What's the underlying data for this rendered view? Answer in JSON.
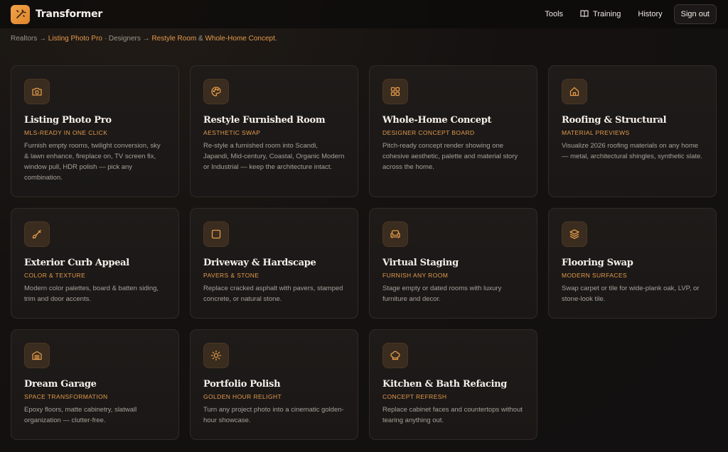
{
  "header": {
    "brand": "Transformer",
    "nav": [
      {
        "label": "Tools",
        "icon": ""
      },
      {
        "label": "Training",
        "icon": "book-icon"
      },
      {
        "label": "History",
        "icon": ""
      }
    ],
    "signout": "Sign out"
  },
  "intro": {
    "realtors": "Realtors →",
    "listing_photo_pro": "Listing Photo Pro",
    "designers": "· Designers →",
    "restyle_room": "Restyle Room",
    "amp": "&",
    "whole_home": "Whole-Home Concept",
    "period": "."
  },
  "colors": {
    "accent": "#e39a4b",
    "bg": "#141110",
    "card": "#1c1917"
  },
  "cards": [
    {
      "icon": "camera-icon",
      "title": "Listing Photo Pro",
      "subtitle": "MLS-READY IN ONE CLICK",
      "desc": "Furnish empty rooms, twilight conversion, sky & lawn enhance, fireplace on, TV screen fix, window pull, HDR polish — pick any combination."
    },
    {
      "icon": "palette-icon",
      "title": "Restyle Furnished Room",
      "subtitle": "AESTHETIC SWAP",
      "desc": "Re-style a furnished room into Scandi, Japandi, Mid-century, Coastal, Organic Modern or Industrial — keep the architecture intact."
    },
    {
      "icon": "grid-icon",
      "title": "Whole-Home Concept",
      "subtitle": "DESIGNER CONCEPT BOARD",
      "desc": "Pitch-ready concept render showing one cohesive aesthetic, palette and material story across the home."
    },
    {
      "icon": "home-icon",
      "title": "Roofing & Structural",
      "subtitle": "MATERIAL PREVIEWS",
      "desc": "Visualize 2026 roofing materials on any home — metal, architectural shingles, synthetic slate."
    },
    {
      "icon": "paintbrush-icon",
      "title": "Exterior Curb Appeal",
      "subtitle": "COLOR & TEXTURE",
      "desc": "Modern color palettes, board & batten siding, trim and door accents."
    },
    {
      "icon": "square-icon",
      "title": "Driveway & Hardscape",
      "subtitle": "PAVERS & STONE",
      "desc": "Replace cracked asphalt with pavers, stamped concrete, or natural stone."
    },
    {
      "icon": "sofa-icon",
      "title": "Virtual Staging",
      "subtitle": "FURNISH ANY ROOM",
      "desc": "Stage empty or dated rooms with luxury furniture and decor."
    },
    {
      "icon": "layers-icon",
      "title": "Flooring Swap",
      "subtitle": "MODERN SURFACES",
      "desc": "Swap carpet or tile for wide-plank oak, LVP, or stone-look tile."
    },
    {
      "icon": "garage-icon",
      "title": "Dream Garage",
      "subtitle": "SPACE TRANSFORMATION",
      "desc": "Epoxy floors, matte cabinetry, slatwall organization — clutter-free."
    },
    {
      "icon": "sun-icon",
      "title": "Portfolio Polish",
      "subtitle": "GOLDEN HOUR RELIGHT",
      "desc": "Turn any project photo into a cinematic golden-hour showcase."
    },
    {
      "icon": "chef-hat-icon",
      "title": "Kitchen & Bath Refacing",
      "subtitle": "CONCEPT REFRESH",
      "desc": "Replace cabinet faces and countertops without tearing anything out."
    }
  ]
}
